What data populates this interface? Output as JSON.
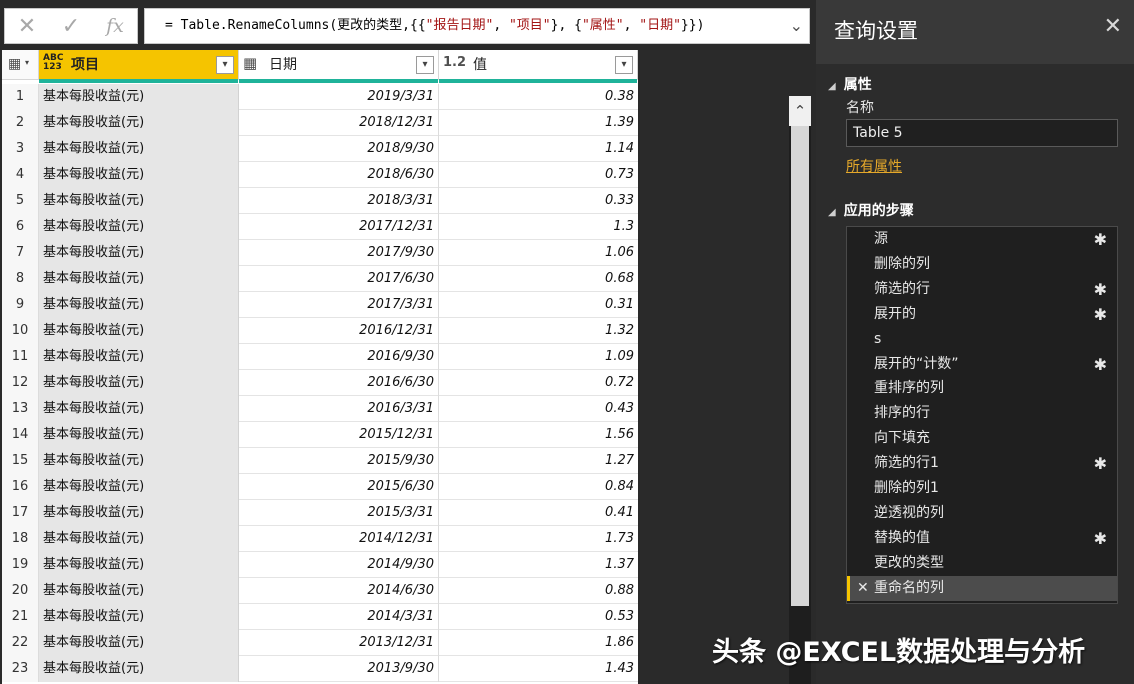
{
  "formula_bar": {
    "cancel_icon": "x-icon",
    "confirm_icon": "check-icon",
    "fx_label": "fx",
    "formula_parts": [
      {
        "text": "= Table.RenameColumns(更改的类型,{{",
        "str": false
      },
      {
        "text": "\"报告日期\"",
        "str": true
      },
      {
        "text": ", ",
        "str": false
      },
      {
        "text": "\"项目\"",
        "str": true
      },
      {
        "text": "}, {",
        "str": false
      },
      {
        "text": "\"属性\"",
        "str": true
      },
      {
        "text": ", ",
        "str": false
      },
      {
        "text": "\"日期\"",
        "str": true
      },
      {
        "text": "}})",
        "str": false
      }
    ],
    "expand_icon": "chevron-down-icon"
  },
  "grid": {
    "columns": [
      {
        "type_label": "ABC 123",
        "label": "项目"
      },
      {
        "type_label": "▦",
        "label": "日期"
      },
      {
        "type_label": "1.2",
        "label": "值"
      }
    ],
    "rows": [
      {
        "n": "1",
        "item": "基本每股收益(元)",
        "date": "2019/3/31",
        "value": "0.38"
      },
      {
        "n": "2",
        "item": "基本每股收益(元)",
        "date": "2018/12/31",
        "value": "1.39"
      },
      {
        "n": "3",
        "item": "基本每股收益(元)",
        "date": "2018/9/30",
        "value": "1.14"
      },
      {
        "n": "4",
        "item": "基本每股收益(元)",
        "date": "2018/6/30",
        "value": "0.73"
      },
      {
        "n": "5",
        "item": "基本每股收益(元)",
        "date": "2018/3/31",
        "value": "0.33"
      },
      {
        "n": "6",
        "item": "基本每股收益(元)",
        "date": "2017/12/31",
        "value": "1.3"
      },
      {
        "n": "7",
        "item": "基本每股收益(元)",
        "date": "2017/9/30",
        "value": "1.06"
      },
      {
        "n": "8",
        "item": "基本每股收益(元)",
        "date": "2017/6/30",
        "value": "0.68"
      },
      {
        "n": "9",
        "item": "基本每股收益(元)",
        "date": "2017/3/31",
        "value": "0.31"
      },
      {
        "n": "10",
        "item": "基本每股收益(元)",
        "date": "2016/12/31",
        "value": "1.32"
      },
      {
        "n": "11",
        "item": "基本每股收益(元)",
        "date": "2016/9/30",
        "value": "1.09"
      },
      {
        "n": "12",
        "item": "基本每股收益(元)",
        "date": "2016/6/30",
        "value": "0.72"
      },
      {
        "n": "13",
        "item": "基本每股收益(元)",
        "date": "2016/3/31",
        "value": "0.43"
      },
      {
        "n": "14",
        "item": "基本每股收益(元)",
        "date": "2015/12/31",
        "value": "1.56"
      },
      {
        "n": "15",
        "item": "基本每股收益(元)",
        "date": "2015/9/30",
        "value": "1.27"
      },
      {
        "n": "16",
        "item": "基本每股收益(元)",
        "date": "2015/6/30",
        "value": "0.84"
      },
      {
        "n": "17",
        "item": "基本每股收益(元)",
        "date": "2015/3/31",
        "value": "0.41"
      },
      {
        "n": "18",
        "item": "基本每股收益(元)",
        "date": "2014/12/31",
        "value": "1.73"
      },
      {
        "n": "19",
        "item": "基本每股收益(元)",
        "date": "2014/9/30",
        "value": "1.37"
      },
      {
        "n": "20",
        "item": "基本每股收益(元)",
        "date": "2014/6/30",
        "value": "0.88"
      },
      {
        "n": "21",
        "item": "基本每股收益(元)",
        "date": "2014/3/31",
        "value": "0.53"
      },
      {
        "n": "22",
        "item": "基本每股收益(元)",
        "date": "2013/12/31",
        "value": "1.86"
      },
      {
        "n": "23",
        "item": "基本每股收益(元)",
        "date": "2013/9/30",
        "value": "1.43"
      }
    ]
  },
  "panel": {
    "title": "查询设置",
    "close_icon": "close-icon",
    "properties_heading": "属性",
    "name_label": "名称",
    "name_value": "Table 5",
    "all_properties_link": "所有属性",
    "steps_heading": "应用的步骤",
    "steps": [
      {
        "label": "源",
        "gear": true
      },
      {
        "label": "删除的列",
        "gear": false
      },
      {
        "label": "筛选的行",
        "gear": true
      },
      {
        "label": "展开的",
        "gear": true
      },
      {
        "label": "s",
        "gear": false
      },
      {
        "label": "展开的“计数”",
        "gear": true
      },
      {
        "label": "重排序的列",
        "gear": false
      },
      {
        "label": "排序的行",
        "gear": false
      },
      {
        "label": "向下填充",
        "gear": false
      },
      {
        "label": "筛选的行1",
        "gear": true
      },
      {
        "label": "删除的列1",
        "gear": false
      },
      {
        "label": "逆透视的列",
        "gear": false
      },
      {
        "label": "替换的值",
        "gear": true
      },
      {
        "label": "更改的类型",
        "gear": false
      },
      {
        "label": "重命名的列",
        "gear": false,
        "active": true
      }
    ]
  },
  "watermark": "头条 @EXCEL数据处理与分析",
  "colors": {
    "accent_yellow": "#f5c400",
    "column_quality_bar": "#1fb39a",
    "link_orange": "#e5a82a"
  }
}
